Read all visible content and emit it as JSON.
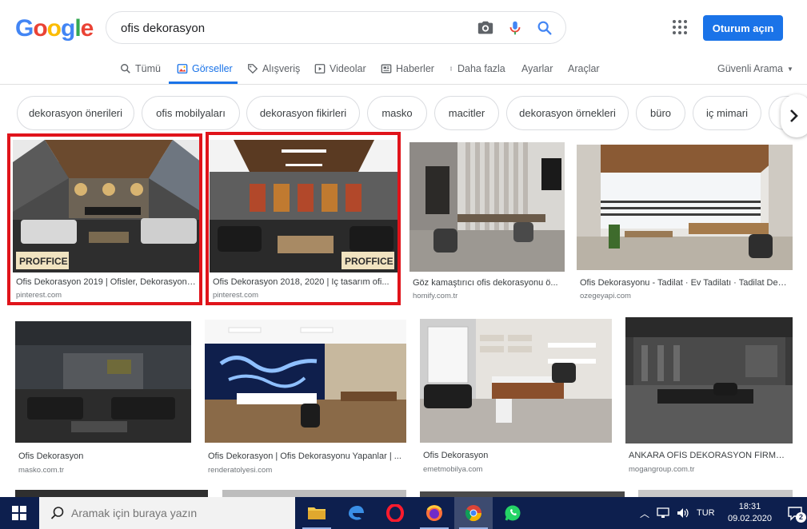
{
  "logo": {
    "g1": "G",
    "o1": "o",
    "o2": "o",
    "g2": "g",
    "l": "l",
    "e": "e"
  },
  "search": {
    "value": "ofis dekorasyon"
  },
  "header": {
    "signin_label": "Oturum açın"
  },
  "tabs": [
    {
      "label": "Tümü"
    },
    {
      "label": "Görseller"
    },
    {
      "label": "Alışveriş"
    },
    {
      "label": "Videolar"
    },
    {
      "label": "Haberler"
    },
    {
      "label": "Daha fazla"
    },
    {
      "label": "Ayarlar"
    },
    {
      "label": "Araçlar"
    }
  ],
  "safe_search": "Güvenli Arama",
  "chips": [
    "dekorasyon önerileri",
    "ofis mobilyaları",
    "dekorasyon fikirleri",
    "masko",
    "macitler",
    "dekorasyon örnekleri",
    "büro",
    "iç mimari",
    ""
  ],
  "results": [
    {
      "title": "Ofis Dekorasyon 2019 | Ofisler, Dekorasyon, ...",
      "source": "pinterest.com",
      "logo_text": "PROFFICE"
    },
    {
      "title": "Ofis Dekorasyon 2018, 2020 | Iç tasarım ofi...",
      "source": "pinterest.com",
      "logo_text": "PROFFICE"
    },
    {
      "title": "Göz kamaştırıcı ofis dekorasyonu ö...",
      "source": "homify.com.tr"
    },
    {
      "title": "Ofis Dekorasyonu - Tadilat · Ev Tadilatı · Tadilat Dek...",
      "source": "ozegeyapi.com"
    },
    {
      "title": "Ofis Dekorasyon",
      "source": "masko.com.tr"
    },
    {
      "title": "Ofis Dekorasyon | Ofis Dekorasyonu Yapanlar | ...",
      "source": "renderatolyesi.com"
    },
    {
      "title": "Ofis Dekorasyon",
      "source": "emetmobilya.com"
    },
    {
      "title": "ANKARA OFİS DEKORASYON FİRMASI ...",
      "source": "mogangroup.com.tr"
    }
  ],
  "taskbar": {
    "search_placeholder": "Aramak için buraya yazın",
    "lang": "TUR",
    "time": "18:31",
    "date": "09.02.2020",
    "notifications": "2"
  },
  "colors": {
    "accent": "#1a73e8",
    "highlight": "#e0141b",
    "taskbar": "#0d1f4e"
  }
}
